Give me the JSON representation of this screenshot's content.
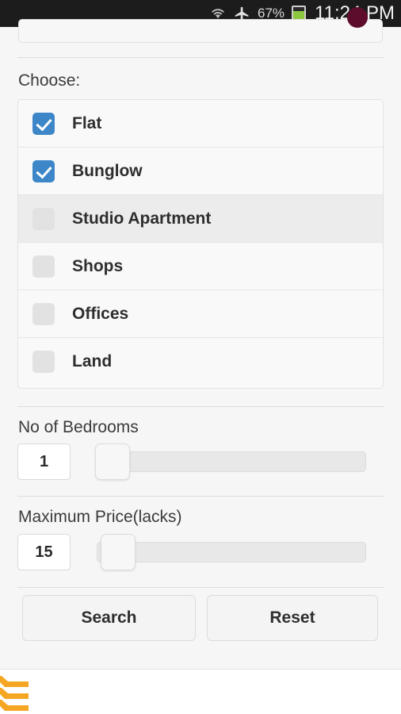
{
  "statusbar": {
    "wifi_icon": "wifi-icon",
    "airplane_icon": "airplane-mode-icon",
    "battery_percent": "67%",
    "battery_icon": "battery-icon",
    "time": "11:24 PM"
  },
  "form": {
    "choose_label": "Choose:",
    "options": [
      {
        "label": "Flat",
        "checked": true,
        "pressed": false
      },
      {
        "label": "Bunglow",
        "checked": true,
        "pressed": false
      },
      {
        "label": "Studio Apartment",
        "checked": false,
        "pressed": true
      },
      {
        "label": "Shops",
        "checked": false,
        "pressed": false
      },
      {
        "label": "Offices",
        "checked": false,
        "pressed": false
      },
      {
        "label": "Land",
        "checked": false,
        "pressed": false
      }
    ],
    "bedrooms": {
      "label": "No of Bedrooms",
      "value": "1"
    },
    "price": {
      "label": "Maximum Price(lacks)",
      "value": "15"
    },
    "search_label": "Search",
    "reset_label": "Reset"
  },
  "footer": {
    "logo_icon": "orange-bars-logo"
  },
  "colors": {
    "checkbox_checked": "#3d87c9",
    "checkbox_unchecked": "#e2e2e2",
    "logo_orange": "#f5a623",
    "page_background": "#f6f6f6",
    "statusbar_background": "#1c1c1c",
    "badge_maroon": "#5d0c2c"
  }
}
